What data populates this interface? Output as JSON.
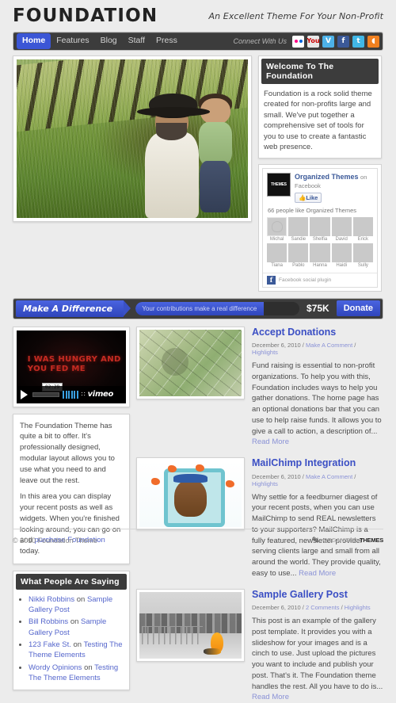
{
  "header": {
    "logo": "FOUNDATION",
    "tagline": "An Excellent Theme For Your Non-Profit"
  },
  "nav": {
    "items": [
      {
        "label": "Home",
        "active": true
      },
      {
        "label": "Features",
        "active": false
      },
      {
        "label": "Blog",
        "active": false
      },
      {
        "label": "Staff",
        "active": false
      },
      {
        "label": "Press",
        "active": false
      }
    ],
    "connect_label": "Connect With Us",
    "social": [
      {
        "name": "flickr-icon",
        "glyph": ""
      },
      {
        "name": "youtube-icon",
        "glyph": "You"
      },
      {
        "name": "vimeo-icon",
        "glyph": "V"
      },
      {
        "name": "facebook-icon",
        "glyph": "f"
      },
      {
        "name": "twitter-icon",
        "glyph": "t"
      },
      {
        "name": "rss-icon",
        "glyph": "◖"
      }
    ]
  },
  "hero": {
    "alt": "Farmer holding a child in a sunlit wheat field with hay bales"
  },
  "welcome_widget": {
    "title": "Welcome To The Foundation",
    "body": "Foundation is a rock solid theme created for non-profits large and small. We've put together a comprehensive set of tools for you to use to create a fantastic web presence."
  },
  "facebook_widget": {
    "page_name": "Organized Themes",
    "on_facebook": "on Facebook",
    "like_label": "Like",
    "count_text": "66 people like Organized Themes",
    "faces": [
      {
        "name": "Michal"
      },
      {
        "name": "Sandie"
      },
      {
        "name": "Shelfia"
      },
      {
        "name": "David"
      },
      {
        "name": "Erick"
      },
      {
        "name": "Tiana"
      },
      {
        "name": "Pablo"
      },
      {
        "name": "Hanna"
      },
      {
        "name": "Haidi"
      },
      {
        "name": "Sully"
      }
    ],
    "footer_text": "Facebook social plugin"
  },
  "donation_bar": {
    "label": "Make A Difference",
    "progress_text": "Your contributions make a real difference",
    "amount": "$75K",
    "button": "Donate",
    "progress_percent": 78
  },
  "video": {
    "overlay_line1": "I WAS HUNGRY AND",
    "overlay_line2": "YOU FED ME",
    "time": "02:29",
    "brand": "vimeo"
  },
  "left_text": {
    "p1_a": "The Foundation Theme has quite a bit to offer. It's professionally designed, modular layout allows you to use what you need to and leave out the rest.",
    "p2_a": "In this area you can display your recent posts as well as widgets. When you're finished looking around, you can go on and ",
    "p2_link": "purchase Foundation",
    "p2_b": " today."
  },
  "saying_widget": {
    "title": "What People Are Saying",
    "items": [
      {
        "author": "Nikki Robbins",
        "on": "on",
        "post": "Sample Gallery Post"
      },
      {
        "author": "Bill Robbins",
        "on": "on",
        "post": "Sample Gallery Post"
      },
      {
        "author": "123 Fake St.",
        "on": "on",
        "post": "Testing The Theme Elements"
      },
      {
        "author": "Wordy Opinions",
        "on": "on",
        "post": "Testing The Theme Elements"
      }
    ]
  },
  "posts": [
    {
      "title": "Accept Donations",
      "date": "December 6, 2010",
      "comments": "Make A Comment",
      "category": "Highlights",
      "excerpt": "Fund raising is essential to non-profit organizations.  To help you with this, Foundation includes ways to help you gather donations.  The home page has an optional donations bar that you can use to help raise funds.  It allows you to give a call to action, a description of...",
      "read_more": "Read More",
      "thumb": "money"
    },
    {
      "title": "MailChimp Integration",
      "date": "December 6, 2010",
      "comments": "Make A Comment",
      "category": "Highlights",
      "excerpt": "Why settle for a feedburner diagest of your recent posts, when you can use MailChimp to send REAL newsletters to your supporters? MailChimp is a fully featured, newsletter provider serving clients large and small from all around the world. They provide quality, easy to use...",
      "read_more": "Read More",
      "thumb": "chimp"
    },
    {
      "title": "Sample Gallery Post",
      "date": "December 6, 2010",
      "comments": "2 Comments",
      "category": "Highlights",
      "excerpt": "This post is an example of the gallery post template. It provides you with a slideshow for your images and is a cinch to use. Just upload the pictures you want to include and publish your post. That's it. The Foundation theme handles the rest. All you have to do is...",
      "read_more": "Read More",
      "thumb": "city"
    }
  ],
  "footer": {
    "copyright": "© 2010 Foundation Theme",
    "logo_org": "ORGANIZED",
    "logo_themes": "THEMES"
  },
  "colors": {
    "accent_blue": "#3b4fc4",
    "dark_bar": "#3c3c3c",
    "page_bg": "#ececec",
    "link": "#5566cc"
  }
}
